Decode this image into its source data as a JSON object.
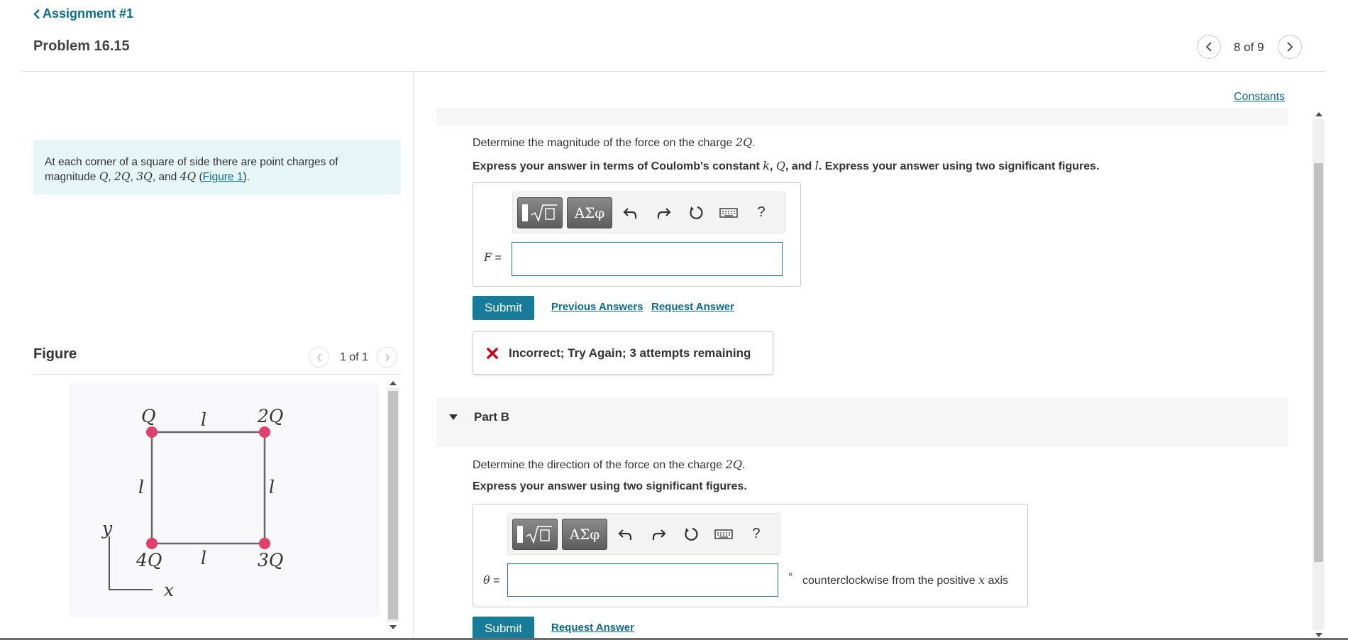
{
  "header": {
    "back_label": "Assignment #1",
    "problem_title": "Problem 16.15",
    "problem_counter": "8 of 9"
  },
  "intro": {
    "text_1": "At each corner of a square of side there are point charges of magnitude ",
    "q1": "Q",
    "sep1": ", ",
    "q2": "2Q",
    "sep2": ", ",
    "q3": "3Q",
    "sep3": ", and ",
    "q4": "4Q",
    "sep4": " (",
    "figure_link": "Figure 1",
    "end": ")."
  },
  "figure": {
    "title": "Figure",
    "counter": "1 of 1",
    "labels": {
      "top_left": "Q",
      "top_right": "2Q",
      "bottom_left": "4Q",
      "bottom_right": "3Q",
      "side_top": "l",
      "side_bottom": "l",
      "side_left": "l",
      "side_right": "l",
      "axis_y": "y",
      "axis_x": "x"
    },
    "charge_color": "#e0406a"
  },
  "constants_link": "Constants",
  "partA": {
    "question_prefix": "Determine the magnitude of the force on the charge ",
    "question_var": "2Q",
    "question_suffix": ".",
    "instruction_1": "Express your answer in terms of Coulomb's constant ",
    "inst_k": "k",
    "inst_sep1": ", ",
    "inst_Q": "Q",
    "inst_sep2": ", and ",
    "inst_l": "l",
    "instruction_2": ". Express your answer using two significant figures.",
    "var_label": "F",
    "equals": " =",
    "input_value": "",
    "submit_label": "Submit",
    "previous_answers": "Previous Answers",
    "request_answer": "Request Answer",
    "feedback": "Incorrect; Try Again; 3 attempts remaining"
  },
  "partB": {
    "title": "Part B",
    "question_prefix": "Determine the direction of the force on the charge ",
    "question_var": "2Q",
    "question_suffix": ".",
    "instruction": "Express your answer using two significant figures.",
    "var_label": "θ",
    "equals": " =",
    "input_value": "",
    "degree_symbol": "°",
    "unit_prefix": "counterclockwise from the positive ",
    "unit_var": "x",
    "unit_suffix": " axis",
    "submit_label": "Submit",
    "request_answer": "Request Answer"
  },
  "toolbar": {
    "greek_label": "ΑΣφ",
    "help_label": "?"
  },
  "colors": {
    "link": "#0a6e92",
    "submit": "#167c99",
    "intro_bg": "#e6f5f6",
    "error_icon": "#d0021b"
  }
}
